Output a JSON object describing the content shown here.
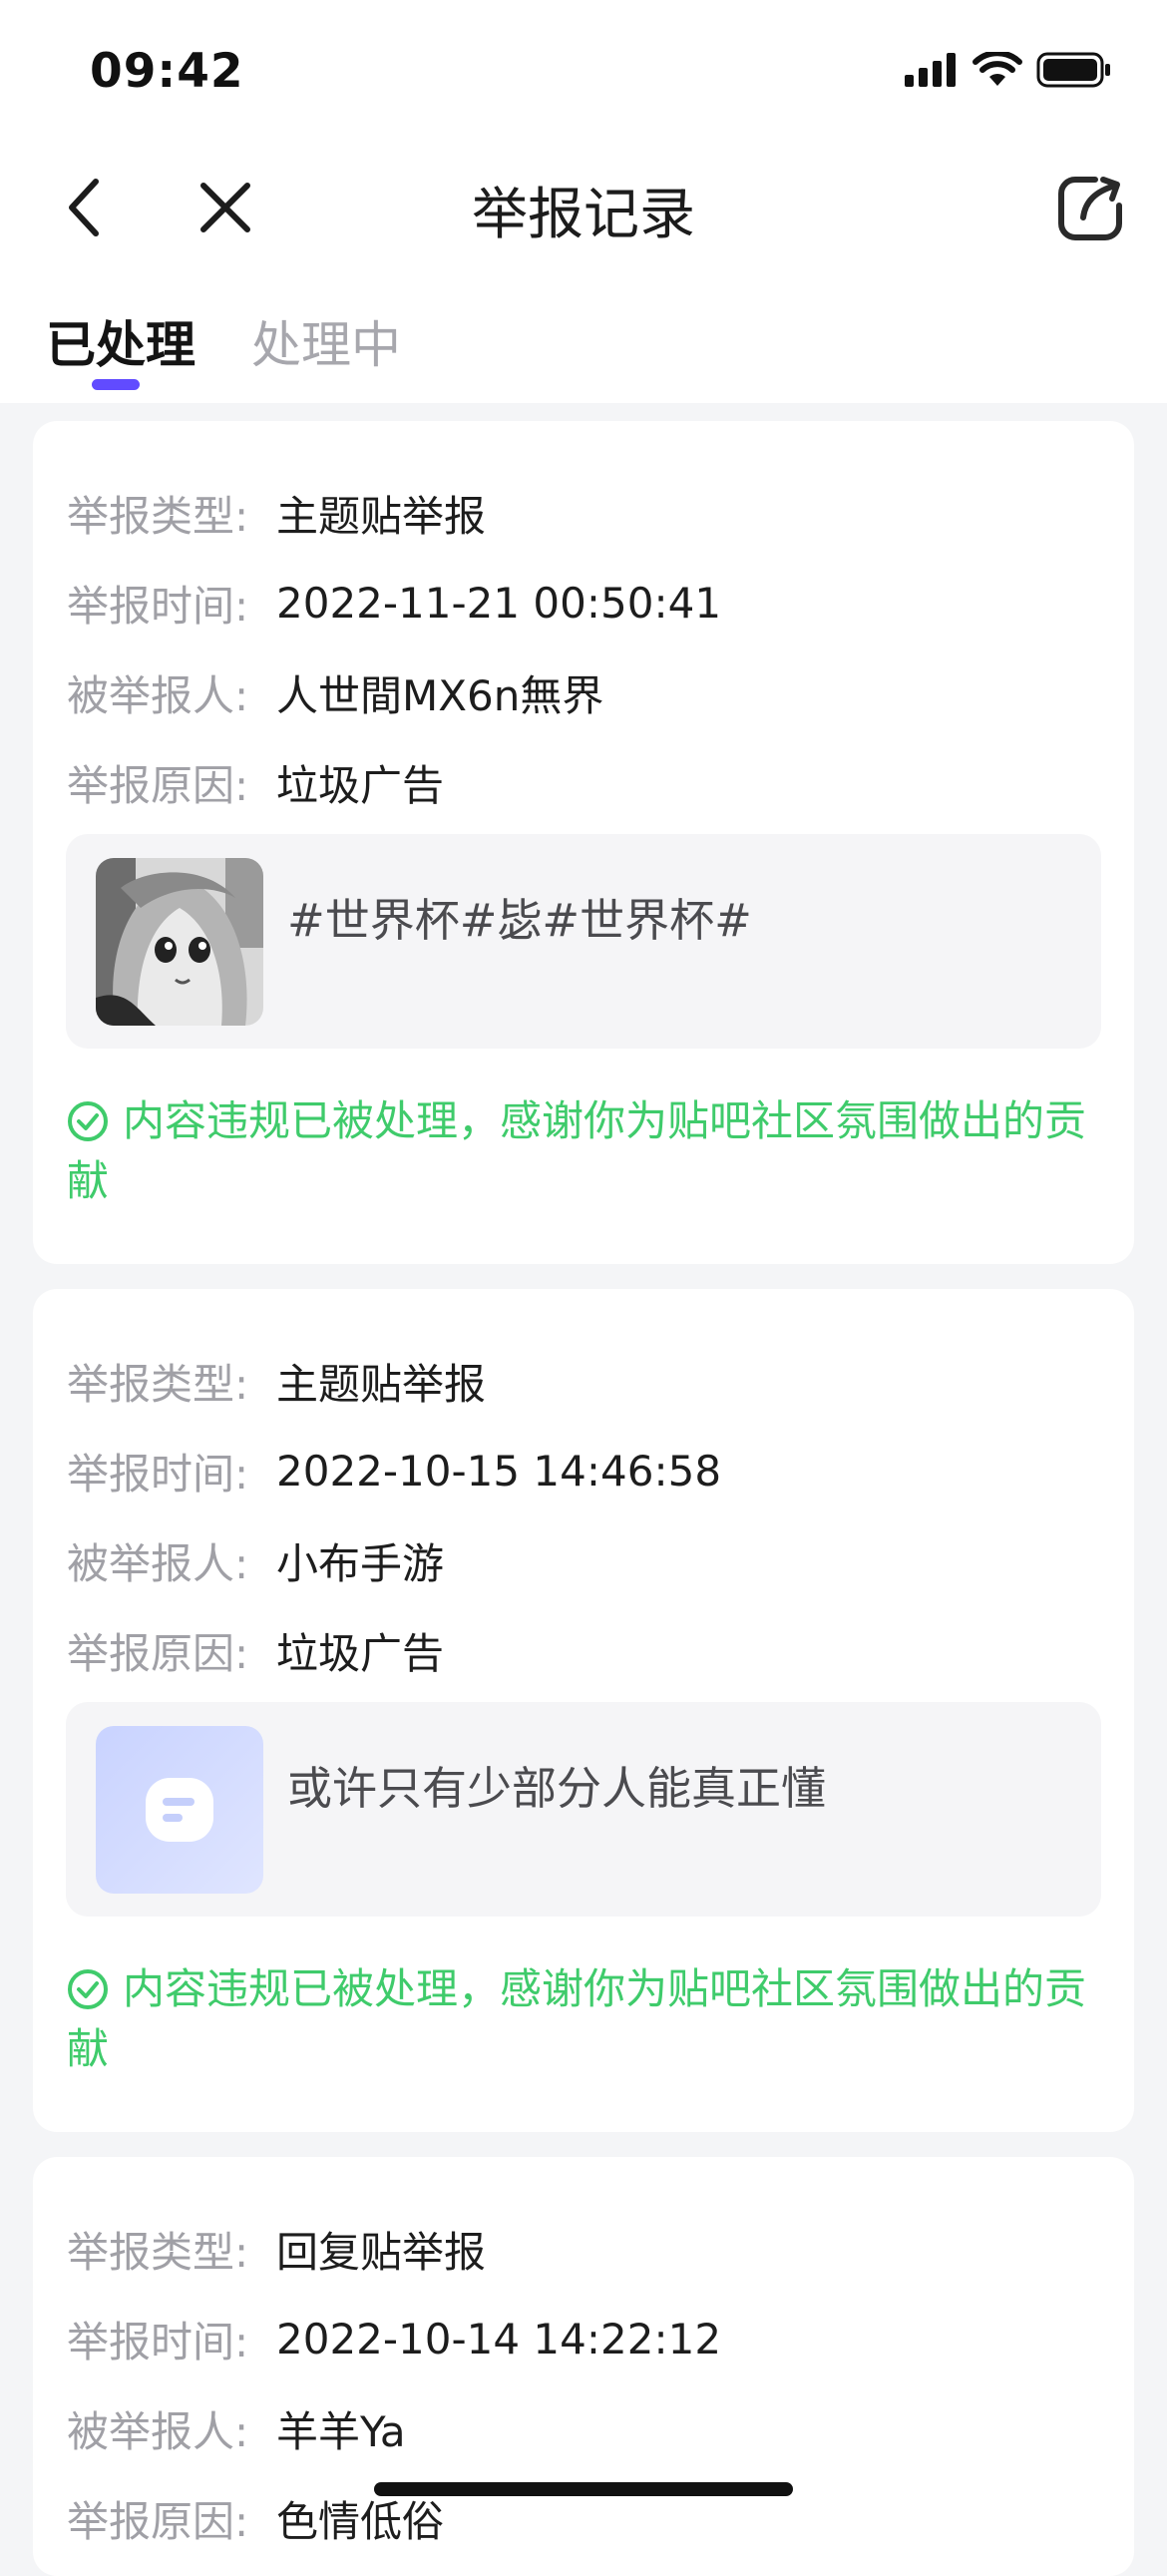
{
  "status_bar": {
    "time": "09:42"
  },
  "nav": {
    "title": "举报记录",
    "back_icon": "chevron-left-icon",
    "close_icon": "close-icon",
    "share_icon": "share-icon"
  },
  "tabs": [
    {
      "label": "已处理",
      "active": true
    },
    {
      "label": "处理中",
      "active": false
    }
  ],
  "colors": {
    "accent": "#614bff",
    "success": "#3fcb6b",
    "label_gray": "#a0a0a6"
  },
  "labels": {
    "type": "举报类型:",
    "time": "举报时间:",
    "reported_user": "被举报人:",
    "reason": "举报原因:"
  },
  "reports": [
    {
      "type": "主题贴举报",
      "time": "2022-11-21 00:50:41",
      "reported_user": "人世間MX6n無界",
      "reason": "垃圾广告",
      "preview_text": "#世界杯#毖#世界杯#",
      "thumbnail": "anime-avatar-image",
      "result": "内容违规已被处理，感谢你为贴吧社区氛围做出的贡献"
    },
    {
      "type": "主题贴举报",
      "time": "2022-10-15 14:46:58",
      "reported_user": "小布手游",
      "reason": "垃圾广告",
      "preview_text": "或许只有少部分人能真正懂",
      "thumbnail": "post-placeholder-icon",
      "result": "内容违规已被处理，感谢你为贴吧社区氛围做出的贡献"
    },
    {
      "type": "回复贴举报",
      "time": "2022-10-14 14:22:12",
      "reported_user": "羊羊Ya",
      "reason": "色情低俗"
    }
  ]
}
